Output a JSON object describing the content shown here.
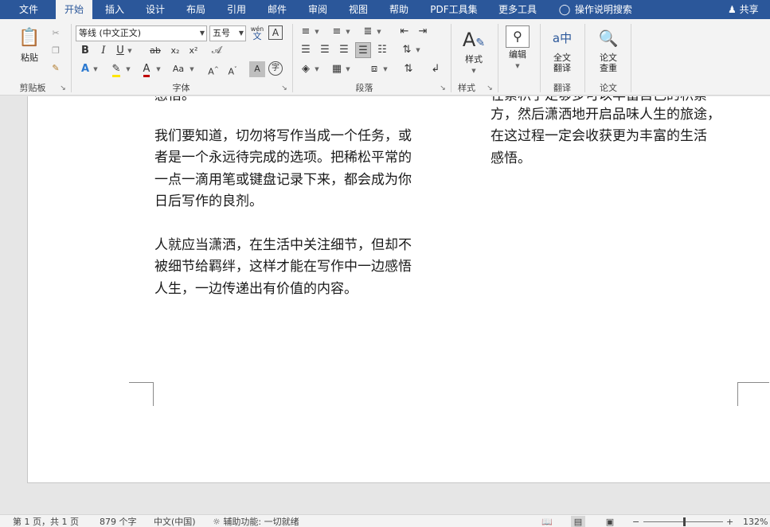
{
  "tabs": {
    "file": "文件",
    "home": "开始",
    "insert": "插入",
    "design": "设计",
    "layout": "布局",
    "references": "引用",
    "mailings": "邮件",
    "review": "审阅",
    "view": "视图",
    "help": "帮助",
    "pdf": "PDF工具集",
    "more": "更多工具"
  },
  "tell_me": "操作说明搜索",
  "share": "共享",
  "clipboard": {
    "paste": "粘贴",
    "group": "剪贴板"
  },
  "font": {
    "name": "等线 (中文正文)",
    "size": "五号",
    "group": "字体",
    "bold": "B",
    "italic": "I",
    "underline": "U",
    "strike": "ab",
    "subscript": "x₂",
    "superscript": "x²",
    "case": "Aa",
    "grow": "A^",
    "shrink": "A˅",
    "pinyin_top": "wén",
    "pinyin_char": "文",
    "char_border": "A",
    "char_shade": "A",
    "enclose": "字"
  },
  "paragraph": {
    "group": "段落"
  },
  "styles": {
    "button": "样式",
    "group": "样式"
  },
  "editing": {
    "button": "编辑"
  },
  "translate": {
    "button_line1": "全文",
    "button_line2": "翻译",
    "group": "翻译"
  },
  "paper": {
    "button_line1": "论文",
    "button_line2": "查重",
    "group": "论文"
  },
  "document": {
    "top_fragment": "感悟。",
    "left_paragraphs": [
      [
        "我们要知道，切勿将写作当成一个任务，或",
        "者是一个永远待完成的选项。把稀松平常的",
        "一点一滴用笔或键盘记录下来，都会成为你",
        "日后写作的良剂。"
      ],
      [
        "人就应当潇洒，在生活中关注细节，但却不",
        "被细节给羁绊，这样才能在写作中一边感悟",
        "人生，一边传递出有价值的内容。"
      ]
    ],
    "right_top_fragment": "在累积了足够多可以丰富自己的积累",
    "right_lines": [
      "方，然后潇洒地开启品味人生的旅途，",
      "在这过程一定会收获更为丰富的生活",
      "感悟。"
    ]
  },
  "status": {
    "page": "第 1 页，共 1 页",
    "words": "879 个字",
    "language": "中文(中国)",
    "accessibility": "辅助功能: 一切就绪",
    "zoom_minus": "−",
    "zoom_plus": "+",
    "zoom": "132%"
  }
}
